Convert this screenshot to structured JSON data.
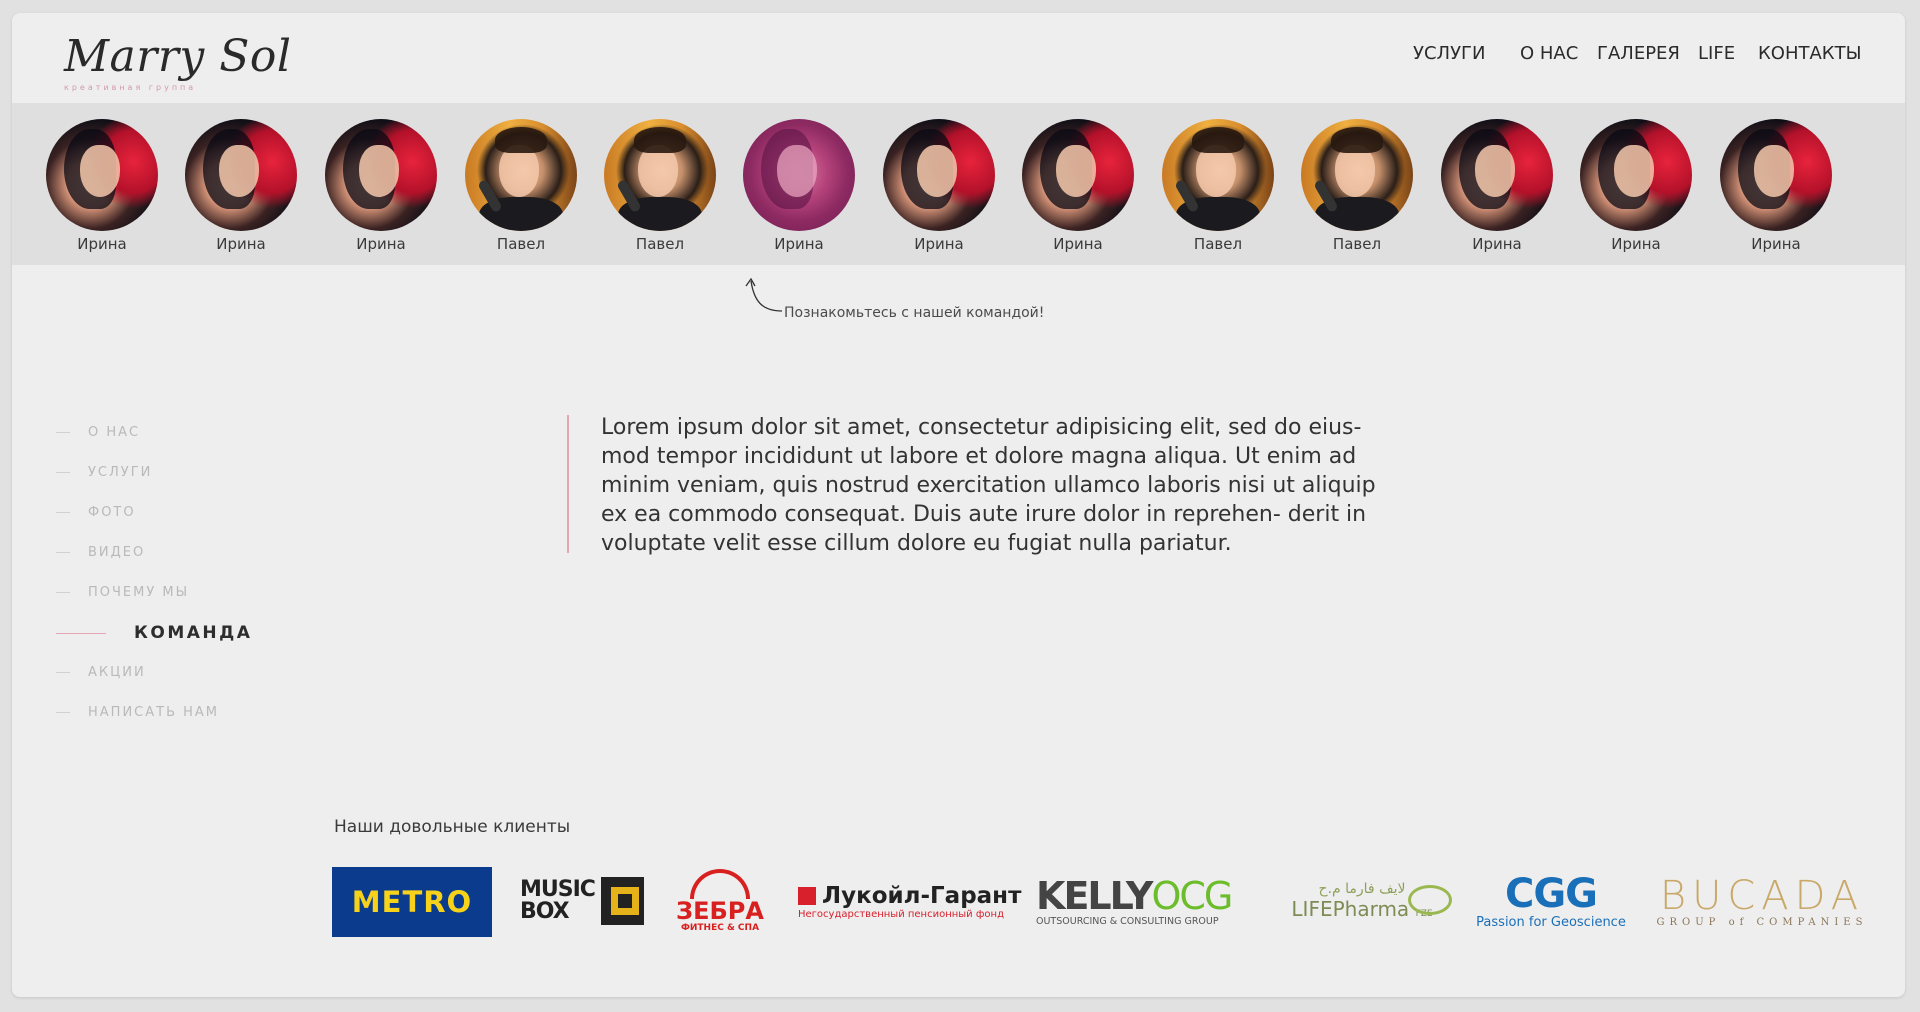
{
  "brand": {
    "logo_name": "Marry Sol",
    "logo_subtitle": "креативная группа",
    "accent_color": "#e7a4b5"
  },
  "nav": [
    {
      "label": "УСЛУГИ"
    },
    {
      "label": "О НАС"
    },
    {
      "label": "ГАЛЕРЕЯ"
    },
    {
      "label": "LIFE"
    },
    {
      "label": "КОНТАКТЫ"
    }
  ],
  "team": [
    {
      "name": "Ирина",
      "photo": "irina"
    },
    {
      "name": "Ирина",
      "photo": "irina"
    },
    {
      "name": "Ирина",
      "photo": "irina"
    },
    {
      "name": "Павел",
      "photo": "pavel"
    },
    {
      "name": "Павел",
      "photo": "pavel"
    },
    {
      "name": "Ирина",
      "photo": "pink"
    },
    {
      "name": "Ирина",
      "photo": "irina"
    },
    {
      "name": "Ирина",
      "photo": "irina"
    },
    {
      "name": "Павел",
      "photo": "pavel"
    },
    {
      "name": "Павел",
      "photo": "pavel"
    },
    {
      "name": "Ирина",
      "photo": "irina"
    },
    {
      "name": "Ирина",
      "photo": "irina"
    },
    {
      "name": "Ирина",
      "photo": "irina"
    }
  ],
  "team_caption": "Познакомьтесь с нашей командой!",
  "side_menu": {
    "items": [
      {
        "label": "О НАС",
        "active": false
      },
      {
        "label": "УСЛУГИ",
        "active": false
      },
      {
        "label": "ФОТО",
        "active": false
      },
      {
        "label": "ВИДЕО",
        "active": false
      },
      {
        "label": "ПОЧЕМУ МЫ",
        "active": false
      },
      {
        "label": "КОМАНДА",
        "active": true
      },
      {
        "label": "АКЦИИ",
        "active": false
      },
      {
        "label": "НАПИСАТЬ НАМ",
        "active": false
      }
    ]
  },
  "main_text": "Lorem ipsum dolor sit amet, consectetur adipisicing elit, sed do eius- mod tempor incididunt ut labore et dolore magna aliqua. Ut enim ad minim veniam, quis nostrud exercitation ullamco laboris nisi ut aliquip ex ea commodo consequat. Duis aute irure dolor in reprehen- derit in voluptate velit esse cillum dolore eu fugiat nulla pariatur.",
  "clients": {
    "title": "Наши довольные клиенты",
    "metro": "METRO",
    "musicbox_1": "MUSIC",
    "musicbox_2": "BOX",
    "zebra": "ЗЕБРА",
    "zebra_sub": "ФИТНЕС & СПА",
    "lukoil": "Лукойл-Гарант",
    "lukoil_sub": "Негосударственный пенсионный фонд",
    "kelly_1": "KELLY",
    "kelly_2": "OCG",
    "kelly_sub": "OUTSOURCING & CONSULTING GROUP",
    "life_ar": "لايف فارما م.ح",
    "life": "LIFEPharma",
    "life_fze": "FZE",
    "cgg": "CGG",
    "cgg_sub": "Passion for Geoscience",
    "bucada": "BUCADA",
    "bucada_sub": "GROUP of COMPANIES"
  }
}
